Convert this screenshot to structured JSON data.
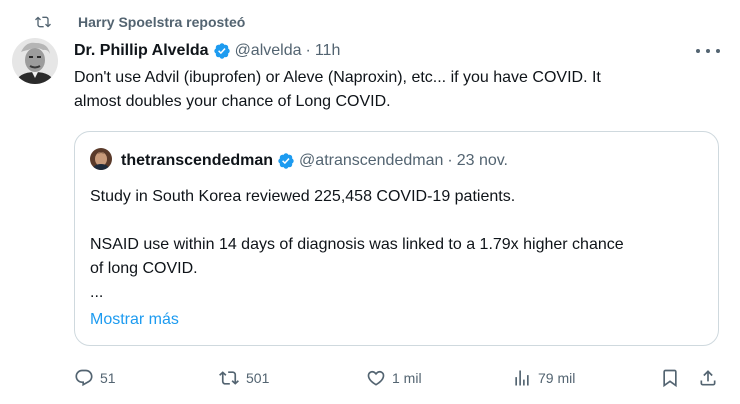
{
  "repost": {
    "text": "Harry Spoelstra reposteó",
    "icon": "repost-icon"
  },
  "author": {
    "name": "Dr. Phillip Alvelda",
    "handle": "@alvelda",
    "separator": "·",
    "time": "11h",
    "verified_icon": "verified-badge-icon",
    "avatar_icon": "avatar-portrait"
  },
  "post": {
    "line1": "Don't use Advil (ibuprofen) or Aleve (Naproxin), etc... if you have COVID. It",
    "line2": "almost doubles your chance of Long COVID."
  },
  "quote": {
    "name": "thetranscendedman",
    "handle": "@atranscendedman",
    "separator": "·",
    "time": "23 nov.",
    "para1": "Study in South Korea reviewed 225,458 COVID-19 patients.",
    "para2_line1": "NSAID use within 14 days of diagnosis was linked to a 1.79x higher chance",
    "para2_line2": "of long COVID.",
    "ellipsis": "...",
    "show_more": "Mostrar más"
  },
  "actions": {
    "replies": "51",
    "reposts": "501",
    "likes": "1 mil",
    "views": "79 mil"
  },
  "colors": {
    "text": "#0f1419",
    "secondary": "#536471",
    "accent": "#1d9bf0",
    "border": "#cfd9de",
    "background": "#ffffff"
  }
}
